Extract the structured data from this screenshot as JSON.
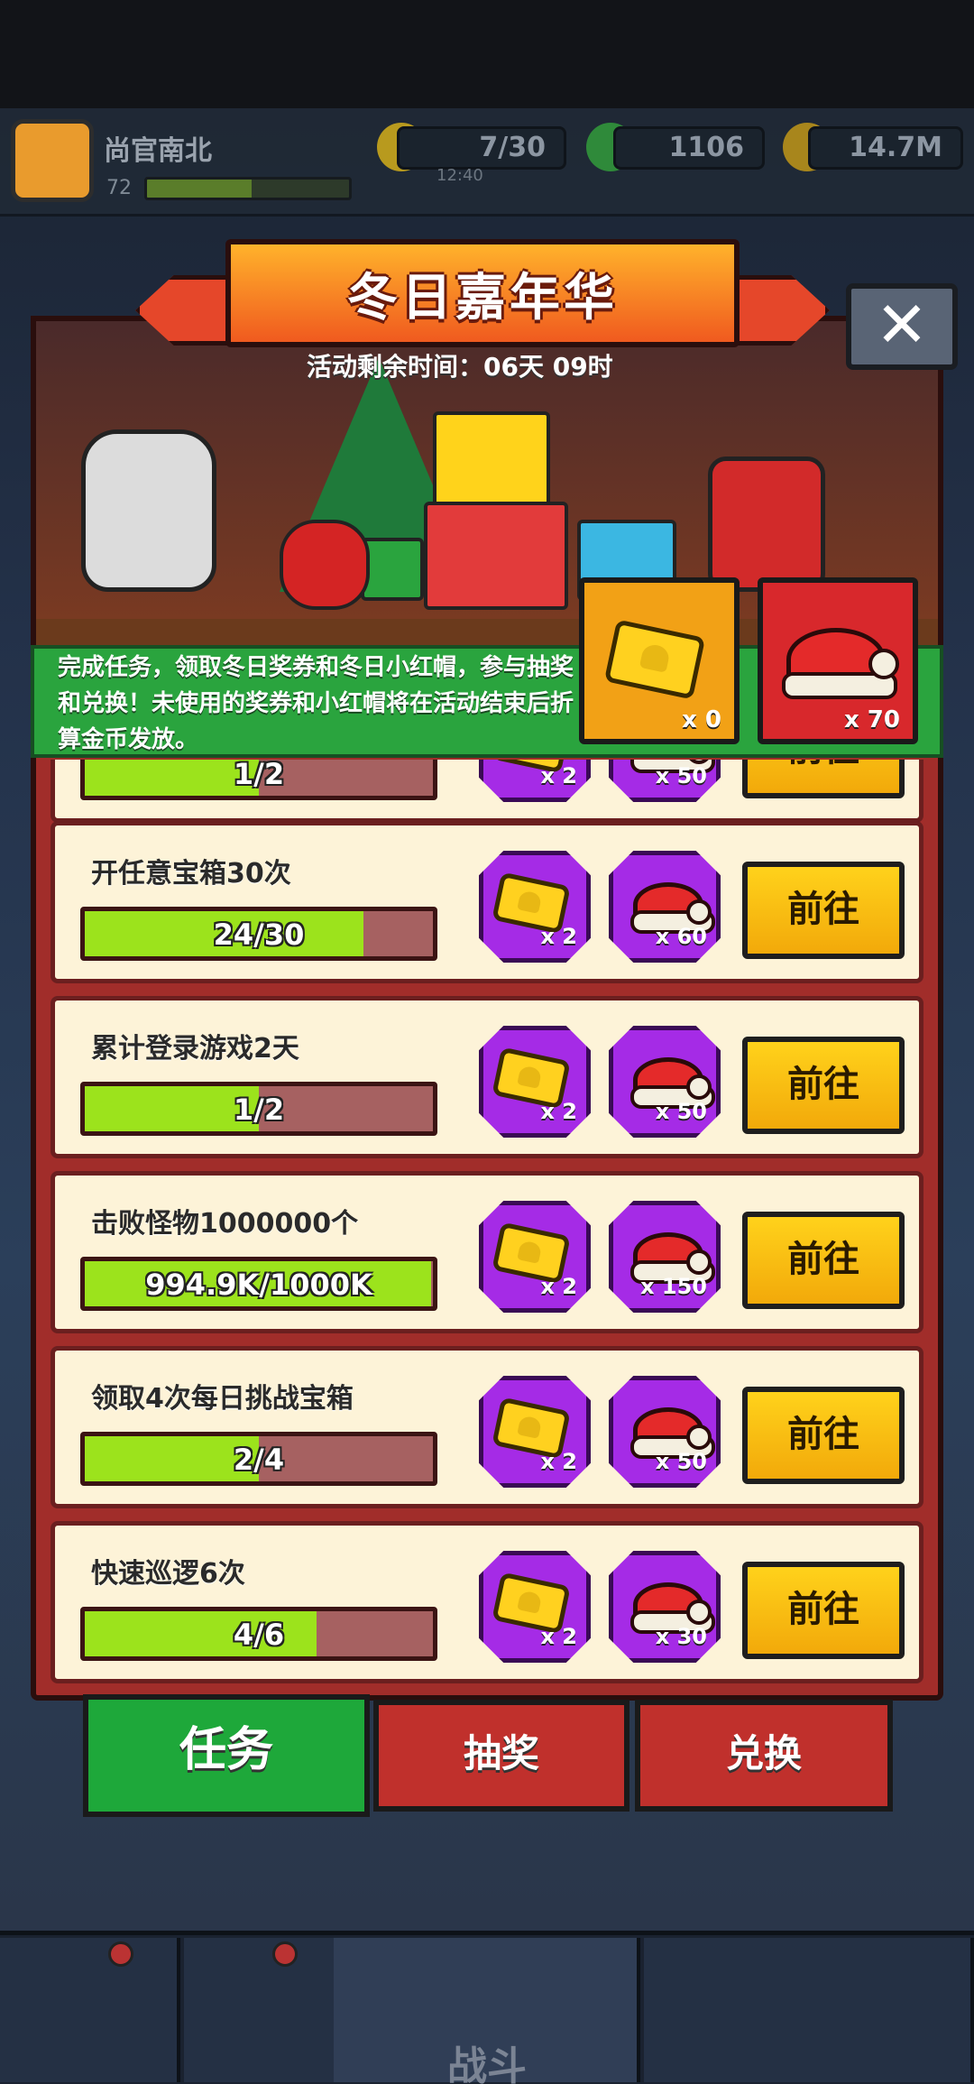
{
  "player": {
    "name": "尚官南北",
    "level": "72",
    "xp_fraction": 0.52
  },
  "resources": {
    "energy": {
      "value": "7/30",
      "timer": "12:40",
      "icon": "lightning-icon"
    },
    "gems": {
      "value": "1106",
      "icon": "green-gem-icon"
    },
    "coins": {
      "value": "14.7M",
      "icon": "gold-coin-icon"
    }
  },
  "event": {
    "title": "冬日嘉年华",
    "timer": "活动剩余时间：06天 09时",
    "description": "完成任务，领取冬日奖券和冬日小红帽，参与抽奖和兑换！未使用的奖券和小红帽将在活动结束后折算金币发放。",
    "currencies": [
      {
        "name": "ticket",
        "icon": "golden-ticket-icon",
        "count": "x 0"
      },
      {
        "name": "hat",
        "icon": "santa-hat-icon",
        "count": "x 70"
      }
    ],
    "close_icon": "close-icon"
  },
  "tasks": [
    {
      "title": "",
      "progress": "1/2",
      "fraction": 0.5,
      "ticket": "x 2",
      "hat": "x 50",
      "button": "前往"
    },
    {
      "title": "开任意宝箱30次",
      "progress": "24/30",
      "fraction": 0.8,
      "ticket": "x 2",
      "hat": "x 60",
      "button": "前往"
    },
    {
      "title": "累计登录游戏2天",
      "progress": "1/2",
      "fraction": 0.5,
      "ticket": "x 2",
      "hat": "x 50",
      "button": "前往"
    },
    {
      "title": "击败怪物1000000个",
      "progress": "994.9K/1000K",
      "fraction": 0.995,
      "ticket": "x 2",
      "hat": "x 150",
      "button": "前往"
    },
    {
      "title": "领取4次每日挑战宝箱",
      "progress": "2/4",
      "fraction": 0.5,
      "ticket": "x 2",
      "hat": "x 50",
      "button": "前往"
    },
    {
      "title": "快速巡逻6次",
      "progress": "4/6",
      "fraction": 0.667,
      "ticket": "x 2",
      "hat": "x 30",
      "button": "前往"
    }
  ],
  "tabs": [
    {
      "label": "任务",
      "active": true
    },
    {
      "label": "抽奖",
      "active": false
    },
    {
      "label": "兑换",
      "active": false
    }
  ],
  "bottom_nav": [
    {
      "name": "shop",
      "icon": "shop-icon"
    },
    {
      "name": "weapons",
      "icon": "gun-icon"
    },
    {
      "name": "battle",
      "icon": "star-swords-icon",
      "label": "战斗"
    },
    {
      "name": "talents",
      "icon": "stars-orb-icon"
    },
    {
      "name": "dna",
      "icon": "dna-icon"
    }
  ],
  "colors": {
    "panel_red": "#a12d2a",
    "task_bg": "#fdf3d8",
    "progress_green": "#9ce31c",
    "go_button": "#ffd21b",
    "tab_active": "#1ea83a",
    "reward_purple": "#a52be6"
  }
}
